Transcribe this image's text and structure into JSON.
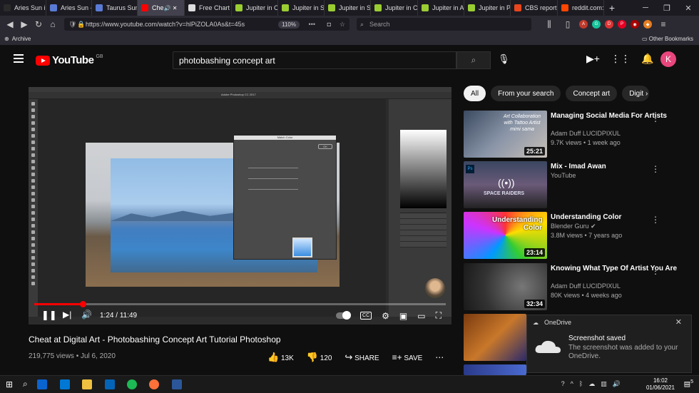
{
  "browser": {
    "tabs": [
      {
        "label": "Aries Sun i",
        "color": "#2a2a2a"
      },
      {
        "label": "Aries Sun -",
        "color": "#5a7bd5"
      },
      {
        "label": "Taurus Sun",
        "color": "#5a7bd5"
      },
      {
        "label": "Che",
        "color": "#ff0000"
      },
      {
        "label": "Free Chart",
        "color": "#dddddd"
      },
      {
        "label": "Jupiter in C",
        "color": "#9acd32"
      },
      {
        "label": "Jupiter in S",
        "color": "#9acd32"
      },
      {
        "label": "Jupiter in S",
        "color": "#9acd32"
      },
      {
        "label": "Jupiter in C",
        "color": "#9acd32"
      },
      {
        "label": "Jupiter in A",
        "color": "#9acd32"
      },
      {
        "label": "Jupiter in P",
        "color": "#9acd32"
      },
      {
        "label": "CBS report",
        "color": "#e8461c"
      },
      {
        "label": "reddit.com:",
        "color": "#ff4500"
      }
    ],
    "new_tab": "+",
    "url": "https://www.youtube.com/watch?v=hlPiZOLA0As&t=45s",
    "zoom": "110%",
    "search_placeholder": "Search",
    "bookmark_archive": "Archive",
    "other_bookmarks": "Other Bookmarks"
  },
  "youtube": {
    "logo_text": "YouTube",
    "region": "GB",
    "search_query": "photobashing concept art",
    "avatar_letter": "K",
    "player": {
      "current_time": "1:24",
      "duration": "11:49",
      "time_sep": " / ",
      "progress_fraction": 0.118,
      "ps_title": "Adobe Photoshop CC 2017",
      "dialog_title": "Match Color"
    },
    "video": {
      "title": "Cheat at Digital Art - Photobashing Concept Art Tutorial Photoshop",
      "views": "219,775 views",
      "date": "Jul 6, 2020",
      "likes": "13K",
      "dislikes": "120",
      "share": "SHARE",
      "save": "SAVE"
    },
    "chips": [
      "All",
      "From your search",
      "Concept art",
      "Digit"
    ],
    "recommendations": [
      {
        "title": "Managing Social Media For Artists",
        "channel": "Adam Duff LUCIDPIXUL",
        "meta": "9.7K views • 1 week ago",
        "duration": "25:21",
        "thumb_text": "Art Collaboration with Tattoo Artist mimi sama"
      },
      {
        "title": "Mix - Imad Awan",
        "channel": "YouTube",
        "meta": "",
        "duration": "",
        "thumb_text": "SPACE RAIDERS"
      },
      {
        "title": "Understanding Color",
        "channel": "Blender Guru",
        "meta": "3.8M views • 7 years ago",
        "duration": "23:14",
        "thumb_text": "Understanding Color"
      },
      {
        "title": "Knowing What Type Of Artist You Are",
        "channel": "Adam Duff LUCIDPIXUL",
        "meta": "80K views • 4 weeks ago",
        "duration": "32:34",
        "thumb_text": ""
      }
    ]
  },
  "toast": {
    "app": "OneDrive",
    "heading": "Screenshot saved",
    "body": "The screenshot was added to your OneDrive."
  },
  "taskbar": {
    "time": "16:02",
    "date": "01/06/2021",
    "notifications": "5"
  }
}
